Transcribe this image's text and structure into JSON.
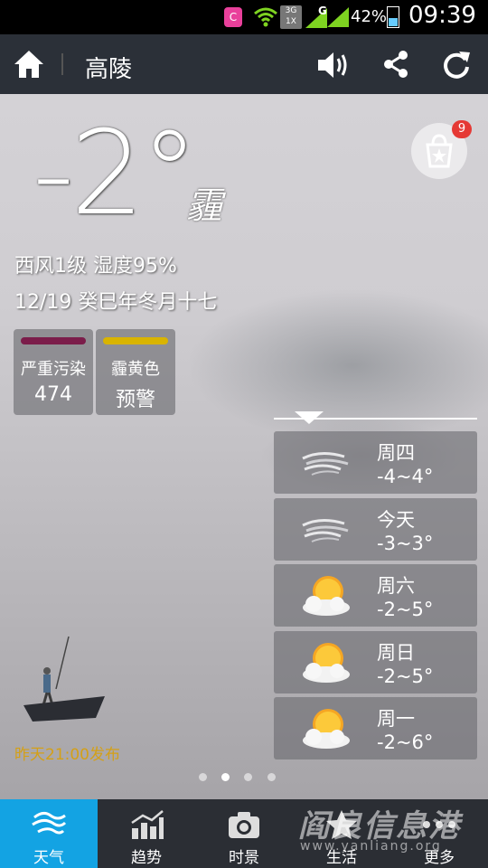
{
  "status_bar": {
    "app_badge": "C",
    "network_3g": "3G",
    "network_1x": "1X",
    "network_g": "G",
    "battery": "42%",
    "battery_level": 0.42,
    "time": "09:39"
  },
  "title_bar": {
    "city": "高陵",
    "icons": [
      "home-icon",
      "speaker-icon",
      "share-icon",
      "refresh-icon"
    ]
  },
  "current": {
    "temperature": "-2°",
    "condition": "霾",
    "wind_humidity": "西风1级 湿度95%",
    "date_line": "12/19 癸巳年冬月十七",
    "store_badge": "9"
  },
  "aqi": {
    "pollution_label": "严重污染",
    "pollution_value": "474",
    "pollution_color": "#7b1d4a",
    "warning_label": "霾黄色",
    "warning_value": "预警",
    "warning_color": "#d9b400"
  },
  "forecast": [
    {
      "day": "周四",
      "range": "-4~4°",
      "icon": "haze-icon"
    },
    {
      "day": "今天",
      "range": "-3~3°",
      "icon": "haze-icon"
    },
    {
      "day": "周六",
      "range": "-2~5°",
      "icon": "sun-cloud-icon"
    },
    {
      "day": "周日",
      "range": "-2~5°",
      "icon": "sun-cloud-icon"
    },
    {
      "day": "周一",
      "range": "-2~6°",
      "icon": "sun-cloud-icon"
    }
  ],
  "published": "昨天21:00发布",
  "pager": {
    "count": 4,
    "active": 2
  },
  "bottom_nav": [
    {
      "label": "天气",
      "icon": "weather-icon",
      "active": true
    },
    {
      "label": "趋势",
      "icon": "trend-icon",
      "active": false
    },
    {
      "label": "时景",
      "icon": "camera-icon",
      "active": false
    },
    {
      "label": "生活",
      "icon": "star-icon",
      "active": false
    },
    {
      "label": "更多",
      "icon": "more-icon",
      "active": false
    }
  ],
  "watermark": {
    "title": "阎良信息港",
    "url": "www.yanliang.org"
  },
  "colors": {
    "accent": "#13a3e3",
    "titlebar": "#2b3038",
    "published": "#d4a017"
  }
}
